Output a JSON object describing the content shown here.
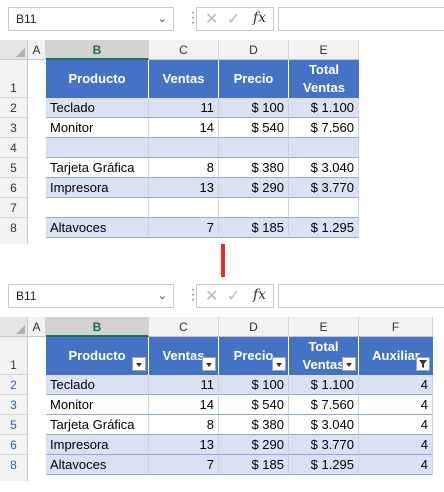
{
  "panels": [
    {
      "namebox": "B11",
      "col_headers": [
        "A",
        "B",
        "C",
        "D",
        "E"
      ],
      "row_numbers": [
        "1",
        "2",
        "3",
        "4",
        "5",
        "6",
        "7",
        "8"
      ],
      "header": [
        "Producto",
        "Ventas",
        "Precio",
        "Total Ventas"
      ],
      "rows": [
        [
          "Teclado",
          "11",
          "$ 100",
          "$ 1.100"
        ],
        [
          "Monitor",
          "14",
          "$ 540",
          "$ 7.560"
        ],
        [
          "",
          "",
          "",
          ""
        ],
        [
          "Tarjeta Gráfica",
          "8",
          "$ 380",
          "$ 3.040"
        ],
        [
          "Impresora",
          "13",
          "$ 290",
          "$ 3.770"
        ],
        [
          "",
          "",
          "",
          ""
        ],
        [
          "Altavoces",
          "7",
          "$ 185",
          "$ 1.295"
        ]
      ]
    },
    {
      "namebox": "B11",
      "col_headers": [
        "A",
        "B",
        "C",
        "D",
        "E",
        "F"
      ],
      "row_numbers": [
        "1",
        "2",
        "3",
        "5",
        "6",
        "8"
      ],
      "header": [
        "Producto",
        "Ventas",
        "Precio",
        "Total Ventas",
        "Auxiliar"
      ],
      "rows": [
        [
          "Teclado",
          "11",
          "$ 100",
          "$ 1.100",
          "4"
        ],
        [
          "Monitor",
          "14",
          "$ 540",
          "$ 7.560",
          "4"
        ],
        [
          "Tarjeta Gráfica",
          "8",
          "$ 380",
          "$ 3.040",
          "4"
        ],
        [
          "Impresora",
          "13",
          "$ 290",
          "$ 3.770",
          "4"
        ],
        [
          "Altavoces",
          "7",
          "$ 185",
          "$ 1.295",
          "4"
        ]
      ]
    }
  ],
  "icons": {
    "dropdown": "chevron-down-icon",
    "cancel": "cancel-x-icon",
    "enter": "checkmark-icon",
    "function": "fx-icon",
    "filter_button": "filter-dropdown-icon",
    "filter_active": "filter-funnel-icon",
    "arrow": "down-arrow-icon"
  },
  "colors": {
    "header_fill": "#4472c4",
    "band_fill": "#d9e1f2",
    "arrow": "#e03131",
    "selected_column": "#217346"
  }
}
